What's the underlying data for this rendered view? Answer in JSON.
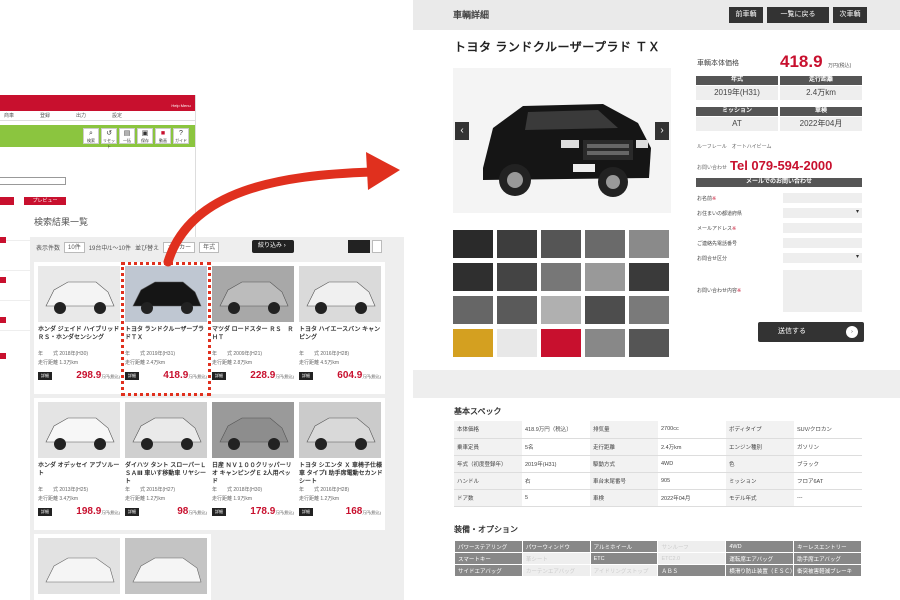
{
  "admin": {
    "help_label": "Help Menu",
    "menu": [
      "商車",
      "登録",
      "出力",
      "設定"
    ],
    "tools": [
      {
        "icon": "search-icon",
        "label": "検索"
      },
      {
        "icon": "reset-icon",
        "label": "リセット"
      },
      {
        "icon": "print-icon",
        "label": "一括"
      },
      {
        "icon": "save-icon",
        "label": "保存"
      },
      {
        "icon": "video-icon",
        "label": "動画"
      },
      {
        "icon": "guide-icon",
        "label": "ガイド"
      }
    ],
    "preview_label": "プレビュー"
  },
  "results": {
    "title": "検索結果一覧",
    "display_count_label": "表示件数",
    "display_count_value": "10件",
    "pager_text": "19台中/1〜10件",
    "sort_label": "並び替え",
    "maker_value": "メーカー",
    "year_value": "年式",
    "narrow_label": "絞り込み",
    "cards": [
      {
        "name": "ホンダ ジェイド ハイブリッドＲＳ・ホンダセンシング",
        "year": "年　　式 2018年(H30)",
        "km": "走行距離 1.3万km",
        "price": "298.9",
        "unit": "万円(税込)"
      },
      {
        "name": "トヨタ ランドクルーザープラドＴＸ",
        "year": "年　　式 2019年(H31)",
        "km": "走行距離 2.4万km",
        "price": "418.9",
        "unit": "万円(税込)"
      },
      {
        "name": "マツダ ロードスター ＲＳ　ＲＨＴ",
        "year": "年　　式 2009年(H21)",
        "km": "走行距離 2.8万km",
        "price": "228.9",
        "unit": "万円(税込)"
      },
      {
        "name": "トヨタ ハイエースバン キャンピング",
        "year": "年　　式 2016年(H28)",
        "km": "走行距離 4.5万km",
        "price": "604.9",
        "unit": "万円(税込)"
      },
      {
        "name": "ホンダ オデッセイ アブソルート",
        "year": "年　　式 2013年(H25)",
        "km": "走行距離 3.4万km",
        "price": "198.9",
        "unit": "万円(税込)"
      },
      {
        "name": "ダイハツ タント スローパーＬＳＡⅢ 車いす移動車 リヤシート",
        "year": "年　　式 2015年(H27)",
        "km": "走行距離 1.2万km",
        "price": "98",
        "unit": "万円(税込)"
      },
      {
        "name": "日産 ＮＶ１００クリッパーリオ キャンピングＥ 2人用ベッド",
        "year": "年　　式 2018年(H30)",
        "km": "走行距離 1.9万km",
        "price": "178.9",
        "unit": "万円(税込)"
      },
      {
        "name": "トヨタ シエンタ Ｘ 車椅子仕様車 タイプⅠ 助手席電動セカンドシート",
        "year": "年　　式 2016年(H28)",
        "km": "走行距離 1.2万km",
        "price": "168",
        "unit": "万円(税込)"
      }
    ],
    "detail_btn": "詳細"
  },
  "detail": {
    "header_title": "車輌詳細",
    "prev_btn": "前車輌",
    "back_btn": "一覧に戻る",
    "next_btn": "次車輌",
    "car_title": "トヨタ ランドクルーザープラド ＴＸ",
    "price_label": "車輌本体価格",
    "price_value": "418.9",
    "price_unit": "万円(税込)",
    "specs_grid": [
      {
        "h": "年式",
        "v": "2019年(H31)"
      },
      {
        "h": "走行距離",
        "v": "2.4万km"
      },
      {
        "h": "ミッション",
        "v": "AT"
      },
      {
        "h": "車検",
        "v": "2022年04月"
      }
    ],
    "shop": "ルーフレール　オートハイビーム",
    "tel_label": "お問い合わせ",
    "tel": "Tel 079-594-2000",
    "mail_head": "メールでのお問い合わせ",
    "form": [
      {
        "label": "お名前",
        "req": "※"
      },
      {
        "label": "お住まいの都道府県",
        "req": ""
      },
      {
        "label": "メールアドレス",
        "req": "※"
      },
      {
        "label": "ご連絡先電話番号",
        "req": ""
      },
      {
        "label": "お問合せ区分",
        "req": ""
      },
      {
        "label": "お問い合わせ内容",
        "req": "※"
      }
    ],
    "submit": "送信する",
    "basic_spec_title": "基本スペック",
    "spec_rows": [
      [
        "本体価格",
        "418.9万円（税込）",
        "排気量",
        "2700cc",
        "ボディタイプ",
        "SUV/クロカン"
      ],
      [
        "乗車定員",
        "5名",
        "走行距離",
        "2.4万km",
        "エンジン種別",
        "ガソリン"
      ],
      [
        "年式（初度登録年）",
        "2019年(H31)",
        "駆動方式",
        "4WD",
        "色",
        "ブラック"
      ],
      [
        "ハンドル",
        "右",
        "車台末尾番号",
        "905",
        "ミッション",
        "フロア6AT"
      ],
      [
        "ドア数",
        "5",
        "車検",
        "2022年04月",
        "モデル年式",
        "---"
      ]
    ],
    "options_title": "装備・オプション",
    "options": [
      [
        [
          "パワーステアリング",
          "on"
        ],
        [
          "パワーウィンドウ",
          "on"
        ],
        [
          "アルミホイール",
          "on"
        ],
        [
          "サンルーフ",
          "off"
        ],
        [
          "4WD",
          "on"
        ],
        [
          "キーレスエントリー",
          "on"
        ]
      ],
      [
        [
          "スマートキー",
          "on"
        ],
        [
          "革シート",
          "off"
        ],
        [
          "ETC",
          "on"
        ],
        [
          "ETC2.0",
          "off"
        ],
        [
          "運転席エアバッグ",
          "on"
        ],
        [
          "助手席エアバッグ",
          "on"
        ]
      ],
      [
        [
          "サイドエアバッグ",
          "on"
        ],
        [
          "カーテンエアバッグ",
          "off"
        ],
        [
          "アイドリングストップ",
          "off"
        ],
        [
          "ＡＢＳ",
          "on"
        ],
        [
          "横滑り防止装置（ＥＳＣ）",
          "on"
        ],
        [
          "衝突被害軽減ブレーキ",
          "on"
        ]
      ]
    ]
  },
  "colors": {
    "accent": "#c8102e",
    "arrow": "#e0301e",
    "green": "#8bc53f",
    "dark": "#333333"
  }
}
